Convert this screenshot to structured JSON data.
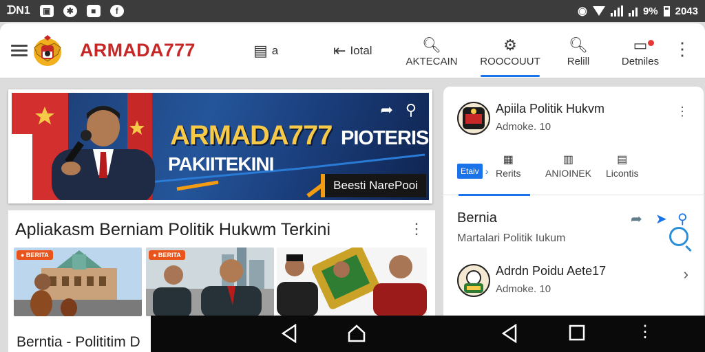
{
  "status": {
    "carrier": "ᗪN1",
    "battery_percent": "9%",
    "time": "2043"
  },
  "header": {
    "brand": "ARMADA777",
    "nav": [
      {
        "label": "a",
        "icon": "list-icon"
      },
      {
        "label": "Iotal",
        "icon": "share-icon"
      },
      {
        "label": "AKTECAIN",
        "icon": "search-icon"
      },
      {
        "label": "ROOCOUUT",
        "icon": "gear-icon"
      },
      {
        "label": "Relill",
        "icon": "search-icon"
      },
      {
        "label": "Detniles",
        "icon": "notification-icon"
      }
    ]
  },
  "banner": {
    "title": "ARMADA777",
    "subtitle_1": "PIOTERIS",
    "subtitle_2": "PAKIITEKINI",
    "tag": "Beesti NarePooi"
  },
  "section": {
    "title": "Apliakasm Berniam Politik Hukwm Terkini",
    "thumbnails": [
      {
        "badge": "● BERITA"
      },
      {
        "badge": "● BERITA"
      },
      {
        "badge": ""
      }
    ],
    "caption": "Berntia  -  Polititim  D"
  },
  "sidebar": {
    "item1": {
      "title": "Apiila Politik Hukvm",
      "meta": "Admoke. 10"
    },
    "tabs": [
      {
        "label": "Etaiv",
        "active": true
      },
      {
        "label": "Rerits"
      },
      {
        "label": "ANIOINEK"
      },
      {
        "label": "Licontis"
      }
    ],
    "section_title": "Bernia",
    "section_subtitle": "Martalari Politik Iukum",
    "item2": {
      "title": "Adrdn Poidu Aete17",
      "meta": "Admoke. 10"
    }
  },
  "colors": {
    "brand_red": "#c62828",
    "accent_blue": "#1a73e8",
    "banner_gold": "#f7c948"
  }
}
